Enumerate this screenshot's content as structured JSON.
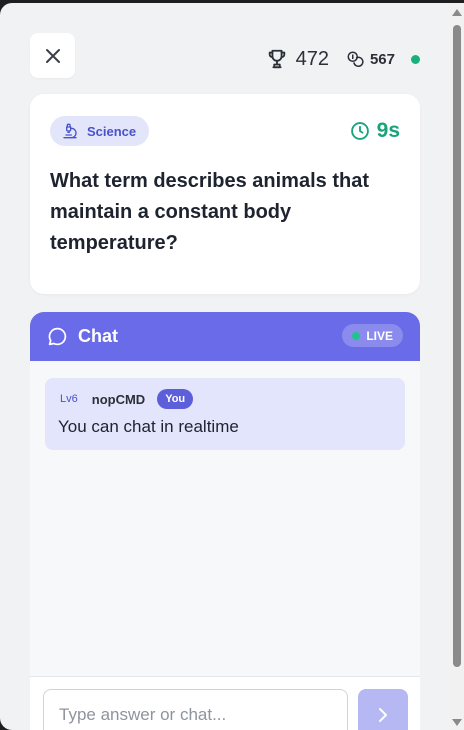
{
  "header": {
    "close_icon": "close-icon",
    "trophy_icon": "trophy-icon",
    "trophies": "472",
    "coin_icon": "coins-icon",
    "coins": "567",
    "online_status_color": "#16b27a"
  },
  "question": {
    "category_icon": "microscope-icon",
    "category": "Science",
    "timer_icon": "clock-icon",
    "time_left": "9s",
    "text": "What term describes animals that maintain a constant body temperature?"
  },
  "chat": {
    "icon": "chat-bubble-icon",
    "title": "Chat",
    "live_label": "LIVE",
    "messages": [
      {
        "level": "Lv6",
        "user": "nopCMD",
        "badge": "You",
        "text": "You can chat in realtime"
      }
    ],
    "input_placeholder": "Type answer or chat...",
    "send_icon": "chevron-right-icon"
  },
  "colors": {
    "accent": "#6a6be8",
    "timer": "#1aa37a",
    "badge_bg": "#e3e6fb"
  }
}
